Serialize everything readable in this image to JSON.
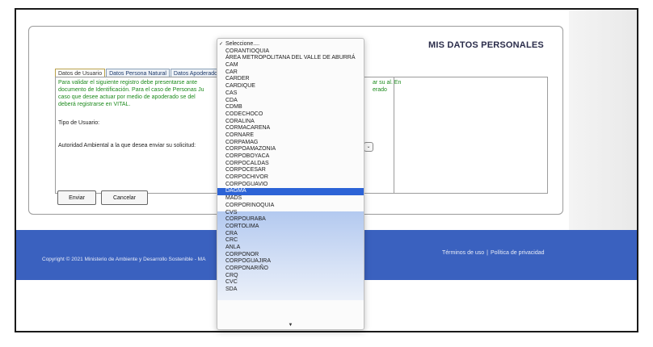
{
  "header": {
    "title": "MIS DATOS PERSONALES"
  },
  "tabs": [
    {
      "label": "Datos de Usuario"
    },
    {
      "label": "Datos Persona Natural"
    },
    {
      "label": "Datos Apoderado"
    }
  ],
  "instructions": {
    "left": "Para validar el siguiente registro debe presentarse ante documento de Identificación. Para el caso de Personas Ju caso que desee actuar por medio de apoderado se del deberá registrarse en VITAL.",
    "right": "ar su al. En erado"
  },
  "form": {
    "user_type_label": "Tipo de Usuario:",
    "authority_label": "Autoridad Ambiental a la que desea enviar su solicitud:"
  },
  "buttons": {
    "send": "Enviar",
    "cancel": "Cancelar"
  },
  "footer": {
    "copyright": "Copyright © 2021 Ministerio de Ambiente y Desarrollo Sostenible - MA",
    "terms": "Términos de uso",
    "privacy": "Política de privacidad",
    "separator": "|"
  },
  "dropdown": {
    "checked_mark": "✓",
    "selected_index": 24,
    "options": [
      "Seleccione....",
      "CORANTIOQUIA",
      "ÁREA METROPOLITANA DEL VALLE DE ABURRÁ",
      "CAM",
      "CAR",
      "CARDER",
      "CARDIQUE",
      "CAS",
      "CDA",
      "CDMB",
      "CODECHOCO",
      "CORALINA",
      "CORMACARENA",
      "CORNARE",
      "CORPAMAG",
      "CORPOAMAZONIA",
      "CORPOBOYACA",
      "CORPOCALDAS",
      "CORPOCESAR",
      "CORPOCHIVOR",
      "CORPOGUAVIO",
      "DAGMA",
      "MADS",
      "CORPORINOQUIA",
      "CVS",
      "CORPOURABA",
      "CORTOLIMA",
      "CRA",
      "CRC",
      "ANLA",
      "CORPONOR",
      "CORPOGUAJIRA",
      "CORPONARIÑO",
      "CRQ",
      "CVC",
      "SDA"
    ],
    "highlighted": "DAGMA",
    "scroll_arrow": "▼"
  },
  "select_stub_arrow": "⌄"
}
